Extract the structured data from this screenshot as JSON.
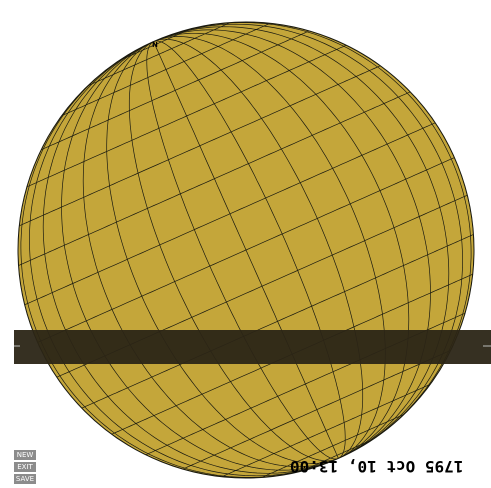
{
  "globe": {
    "fill_color": "#c4a63a",
    "grid_color": "#1a1a10",
    "band_color": "#2b2516",
    "pole_label": "N"
  },
  "controls": {
    "new_label": "NEW",
    "exit_label": "EXIT",
    "save_label": "SAVE"
  },
  "timestamp": {
    "text": "1795 Oct 10, 13:00"
  }
}
